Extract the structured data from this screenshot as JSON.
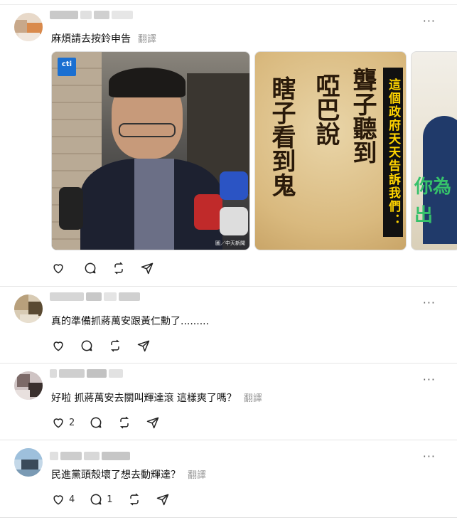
{
  "posts": [
    {
      "text": "麻煩請去按鈴申告",
      "translate": "翻譯",
      "has_gallery": true,
      "likes": "",
      "replies": ""
    },
    {
      "text": "真的準備抓蔣萬安跟黃仁勳了.........",
      "translate": "",
      "likes": "",
      "replies": ""
    },
    {
      "text": "好啦 抓蔣萬安去關叫輝達滾 這樣爽了嗎？",
      "translate": "翻譯",
      "likes": "2",
      "replies": ""
    },
    {
      "text": "民進黨頭殼壞了想去動輝達？",
      "translate": "翻譯",
      "likes": "4",
      "replies": "1"
    }
  ],
  "gallery": {
    "image1": {
      "logo": "cti",
      "caption": "圖／中天新聞"
    },
    "image2": {
      "calligraphy": [
        "聾子聽到",
        "啞巴說",
        "瞎子看到鬼"
      ],
      "banner": "這個政府天天告訴我們："
    },
    "image3": {
      "overlay_text": "你為\n出"
    }
  },
  "more_label": "···",
  "icons": {
    "like": "heart-icon",
    "reply": "comment-icon",
    "repost": "repost-icon",
    "share": "share-icon"
  }
}
